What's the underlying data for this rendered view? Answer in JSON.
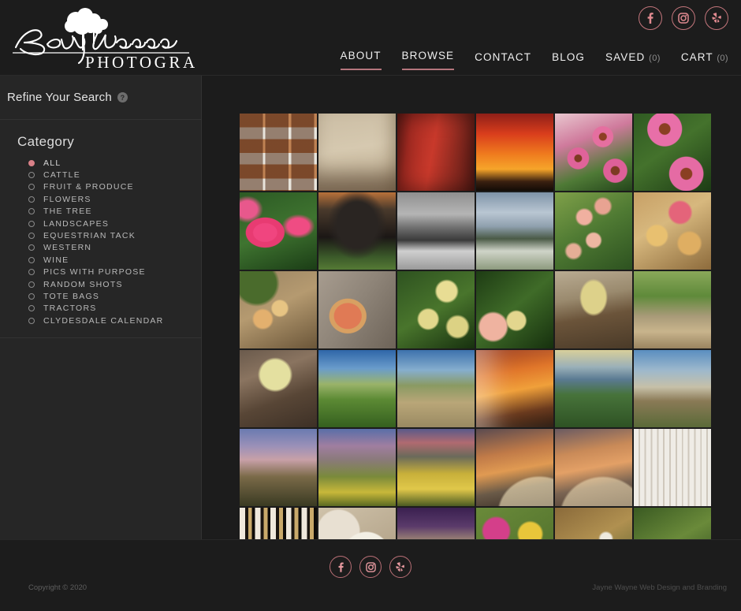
{
  "site": {
    "brand_name": "Becky Hanson",
    "brand_sub": "PHOTOGRAPHY",
    "accent_color": "#d98188",
    "background_color": "#1c1c1c",
    "sidebar_color": "#262626"
  },
  "header": {
    "social": [
      {
        "name": "facebook",
        "glyph": "f"
      },
      {
        "name": "instagram",
        "glyph": ""
      },
      {
        "name": "yelp",
        "glyph": ""
      }
    ],
    "nav": [
      {
        "label": "ABOUT",
        "active": false,
        "count": ""
      },
      {
        "label": "BROWSE",
        "active": true,
        "count": ""
      },
      {
        "label": "CONTACT",
        "active": false,
        "count": ""
      },
      {
        "label": "BLOG",
        "active": false,
        "count": ""
      },
      {
        "label": "SAVED",
        "active": false,
        "count": "(0)"
      },
      {
        "label": "CART",
        "active": false,
        "count": "(0)"
      }
    ]
  },
  "sidebar": {
    "refine_title": "Refine Your Search",
    "help_glyph": "?",
    "facet_title": "Category",
    "categories": [
      {
        "label": "ALL",
        "selected": true
      },
      {
        "label": "CATTLE",
        "selected": false
      },
      {
        "label": "FRUIT & PRODUCE",
        "selected": false
      },
      {
        "label": "FLOWERS",
        "selected": false
      },
      {
        "label": "THE TREE",
        "selected": false
      },
      {
        "label": "LANDSCAPES",
        "selected": false
      },
      {
        "label": "EQUESTRIAN TACK",
        "selected": false
      },
      {
        "label": "WESTERN",
        "selected": false
      },
      {
        "label": "WINE",
        "selected": false
      },
      {
        "label": "PICS WITH PURPOSE",
        "selected": false
      },
      {
        "label": "RANDOM SHOTS",
        "selected": false
      },
      {
        "label": "TOTE BAGS",
        "selected": false
      },
      {
        "label": "TRACTORS",
        "selected": false
      },
      {
        "label": "CLYDESDALE CALENDAR",
        "selected": false
      }
    ]
  },
  "gallery": {
    "columns": 6,
    "tiles": [
      {
        "name": "horse-contact-sheet",
        "alt": "Contact sheet of horse photographs",
        "art": "contact-sheet"
      },
      {
        "name": "reining-book-page",
        "alt": "Book page titled REINING with cattle photo",
        "art": "reining-page"
      },
      {
        "name": "red-gas-pump-ethyl",
        "alt": "Vintage red gas pump with ETHYL sign",
        "art": "gas-pump"
      },
      {
        "name": "windmill-sunset",
        "alt": "Windmill silhouette against red orange sunset",
        "art": "windmill"
      },
      {
        "name": "coneflowers-pink-field",
        "alt": "Pink coneflowers in a field",
        "art": "coneflower-a"
      },
      {
        "name": "coneflowers-closeup",
        "alt": "Close up of pink coneflowers",
        "art": "coneflower-b"
      },
      {
        "name": "pink-tulips",
        "alt": "Pink and white tulips",
        "art": "tulips"
      },
      {
        "name": "black-angus-cattle",
        "alt": "Black Angus cattle facing camera",
        "art": "cattle"
      },
      {
        "name": "orchard-bw",
        "alt": "Black and white orchard under stormy sky",
        "art": "orchard-bw"
      },
      {
        "name": "orchard-color",
        "alt": "Color orchard under cloudy sky",
        "art": "orchard-color"
      },
      {
        "name": "apples-on-tree",
        "alt": "Apples ripening on tree branch",
        "art": "apples-tree"
      },
      {
        "name": "apples-in-basket",
        "alt": "Apples spilling from a woven basket",
        "art": "apples-basket"
      },
      {
        "name": "apple-basket-stone",
        "alt": "Basket of apples on stone wall",
        "art": "apple-basket-stone"
      },
      {
        "name": "single-apple-wood",
        "alt": "Single apple with leaf on weathered wood",
        "art": "single-apple"
      },
      {
        "name": "golden-apples-foliage",
        "alt": "Golden apples among green leaves",
        "art": "golden-apples"
      },
      {
        "name": "apples-branch-leaves",
        "alt": "Apples on a branch with dark green leaves",
        "art": "apples-branch"
      },
      {
        "name": "apple-crate-wood",
        "alt": "Wooden crate filled with apples",
        "art": "apple-crate"
      },
      {
        "name": "orchard-harvest",
        "alt": "Orchard harvest with workers and crates",
        "art": "orchard-harvest"
      },
      {
        "name": "apple-bin-twigs",
        "alt": "Apples in bin surrounded by twigs",
        "art": "apple-bin"
      },
      {
        "name": "cattails-blue-sky",
        "alt": "Cattails and grasses under blue sky",
        "art": "cattails"
      },
      {
        "name": "country-road",
        "alt": "Dirt country road with treeline",
        "art": "country-road"
      },
      {
        "name": "desert-sunset-text",
        "alt": "Desert sunset with text overlay",
        "art": "desert-sunset-text"
      },
      {
        "name": "desert-mountains",
        "alt": "Blue desert mountains above green scrub",
        "art": "desert-mountains"
      },
      {
        "name": "saguaro-rocks",
        "alt": "Saguaro cactus and rock formation",
        "art": "saguaro-rocks"
      },
      {
        "name": "saguaro-dusk",
        "alt": "Saguaro cacti at dusk with purple sky",
        "art": "saguaro-dusk"
      },
      {
        "name": "desert-wildflowers-dusk",
        "alt": "Desert wildflowers at dusk",
        "art": "desert-flowers-dusk"
      },
      {
        "name": "brittlebush-sunset",
        "alt": "Yellow brittlebush flowers at sunset",
        "art": "brittlebush"
      },
      {
        "name": "rainbow-desert-a",
        "alt": "Rainbow over desert with orange storm clouds",
        "art": "rainbow-a"
      },
      {
        "name": "rainbow-desert-b",
        "alt": "Double rainbow over desert ridge",
        "art": "rainbow-b"
      },
      {
        "name": "white-texture-tree",
        "alt": "Light textured image with tree silhouette",
        "art": "white-texture"
      },
      {
        "name": "birch-trees-strip",
        "alt": "Birch tree trunks",
        "art": "birch"
      },
      {
        "name": "baseballs",
        "alt": "Close up of baseballs",
        "art": "baseball"
      },
      {
        "name": "purple-blur",
        "alt": "Blurred purple and tan abstract",
        "art": "purple-blur"
      },
      {
        "name": "flower-bouquet",
        "alt": "Bright flower bouquet on bicycle",
        "art": "bouquet"
      },
      {
        "name": "white-blossoms-a",
        "alt": "White blossoms with autumn foliage",
        "art": "blossoms-a"
      },
      {
        "name": "white-blossoms-b",
        "alt": "White blossoms and green leaves",
        "art": "blossoms-b"
      }
    ]
  },
  "footer": {
    "social": [
      {
        "name": "facebook",
        "glyph": "f"
      },
      {
        "name": "instagram",
        "glyph": ""
      },
      {
        "name": "yelp",
        "glyph": ""
      }
    ],
    "copyright": "Copyright © 2020",
    "credit": "Jayne Wayne Web Design and Branding"
  }
}
